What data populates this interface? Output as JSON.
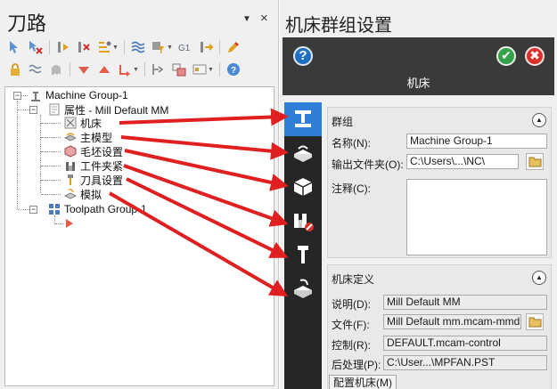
{
  "left_panel": {
    "title": "刀路",
    "pin_glyph": "▼",
    "close_glyph": "×",
    "toolbar_row1": [
      "select-all-icon",
      "deselect-icon",
      "regen-icon",
      "regen-dirty-icon",
      "toolpath-sort-icon",
      "stack-icon",
      "filter-icon",
      "g1-post-icon",
      "post-selected-icon",
      "edit-icon"
    ],
    "toolbar_row2": [
      "lock-icon",
      "wave-icon",
      "ghost-icon",
      "move-down-icon",
      "move-up-icon",
      "insert-arrow-icon",
      "expand-icon",
      "group-icon",
      "display-icon",
      "help-icon"
    ],
    "g1_text": "G1",
    "tree": {
      "machine_group": "Machine Group-1",
      "properties": "属性 - Mill Default MM",
      "children": [
        "机床",
        "主模型",
        "毛坯设置",
        "工件夹紧",
        "刀具设置",
        "模拟"
      ],
      "toolpath_group": "Toolpath Group-1",
      "expand_glyph": "−"
    }
  },
  "right_panel": {
    "title": "机床群组设置",
    "help_glyph": "?",
    "ok_glyph": "✔",
    "cancel_glyph": "✖",
    "header_label": "机床",
    "tabs": [
      "machine-tab",
      "model-tab",
      "stock-tab",
      "fixture-tab",
      "tool-setup-tab",
      "simulation-tab"
    ],
    "group_section": {
      "title": "群组",
      "collapse_glyph": "▲",
      "name_label": "名称(N):",
      "name_value": "Machine Group-1",
      "output_label": "输出文件夹(O):",
      "output_value": "C:\\Users\\...\\NC\\",
      "comment_label": "注释(C):",
      "comment_value": ""
    },
    "machine_section": {
      "title": "机床定义",
      "collapse_glyph": "▲",
      "desc_label": "说明(D):",
      "desc_value": "Mill Default MM",
      "file_label": "文件(F):",
      "file_value": "Mill Default mm.mcam-mmd",
      "control_label": "控制(R):",
      "control_value": "DEFAULT.mcam-control",
      "post_label": "后处理(P):",
      "post_value": "C:\\User...\\MPFAN.PST",
      "config_button": "配置机床(M)"
    }
  },
  "colors": {
    "annotation_arrow": "#e02020",
    "active_tab": "#2f7fd8",
    "tab_strip": "#262626",
    "header_bg": "#3a3a3a"
  }
}
